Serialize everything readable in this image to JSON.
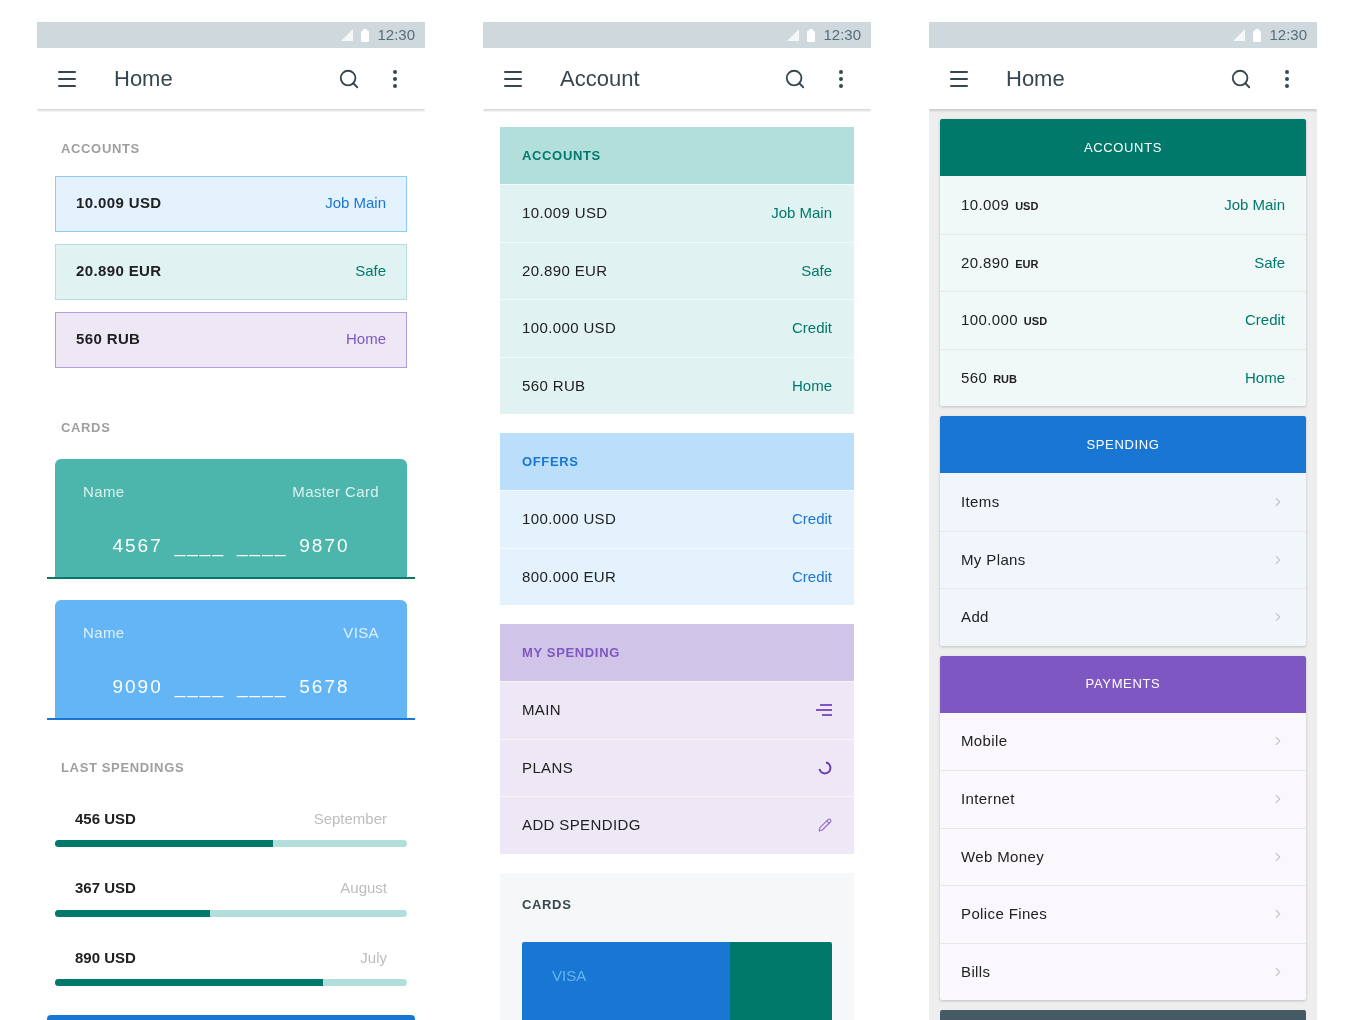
{
  "screens": [
    {
      "status_time": "12:30",
      "title": "Home",
      "accounts_label": "ACCOUNTS",
      "accounts": [
        {
          "amount": "10.009 USD",
          "name": "Job Main",
          "color": "#1976d2"
        },
        {
          "amount": "20.890 EUR",
          "name": "Safe",
          "color": "#00796b"
        },
        {
          "amount": "560 RUB",
          "name": "Home",
          "color": "#7e57c2"
        }
      ],
      "cards_label": "CARDS",
      "cards": [
        {
          "name": "Name",
          "brand": "Master Card",
          "number": [
            "4567",
            "____",
            "____",
            "9870"
          ],
          "color": "#4db6ac"
        },
        {
          "name": "Name",
          "brand": "VISA",
          "number": [
            "9090",
            "____",
            "____",
            "5678"
          ],
          "color": "#64b5f6"
        }
      ],
      "spendings_label": "LAST SPENDINGS",
      "spendings": [
        {
          "amount": "456 USD",
          "month": "September",
          "level": 0.62
        },
        {
          "amount": "367 USD",
          "month": "August",
          "level": 0.44
        },
        {
          "amount": "890 USD",
          "month": "July",
          "level": 0.76
        }
      ]
    },
    {
      "status_time": "12:30",
      "title": "Account",
      "sections": [
        {
          "title": "ACCOUNTS",
          "color": "#00796b",
          "rows": [
            {
              "label": "10.009 USD",
              "value": "Job Main"
            },
            {
              "label": "20.890 EUR",
              "value": "Safe"
            },
            {
              "label": "100.000 USD",
              "value": "Credit"
            },
            {
              "label": "560 RUB",
              "value": "Home"
            }
          ]
        },
        {
          "title": "OFFERS",
          "color": "#1976d2",
          "rows": [
            {
              "label": "100.000 USD",
              "value": "Credit"
            },
            {
              "label": "800.000 EUR",
              "value": "Credit"
            }
          ]
        },
        {
          "title": "MY SPENDING",
          "color": "#7e57c2",
          "rows": [
            {
              "label": "MAIN",
              "kind": "lines"
            },
            {
              "label": "PLANS",
              "kind": "spinner"
            },
            {
              "label": "ADD SPENDIDG",
              "kind": "pencil"
            }
          ]
        }
      ],
      "cards_label": "CARDS",
      "card_brand": "VISA"
    },
    {
      "status_time": "12:30",
      "title": "Home",
      "groups": [
        {
          "title": "ACCOUNTS",
          "color": "#00796b",
          "rows": [
            {
              "amount": "10.009",
              "currency": "USD",
              "value": "Job Main"
            },
            {
              "amount": "20.890",
              "currency": "EUR",
              "value": "Safe"
            },
            {
              "amount": "100.000",
              "currency": "USD",
              "value": "Credit"
            },
            {
              "amount": "560",
              "currency": "RUB",
              "value": "Home"
            }
          ]
        },
        {
          "title": "SPENDING",
          "color": "#1976d2",
          "rows": [
            {
              "label": "Items"
            },
            {
              "label": "My Plans"
            },
            {
              "label": "Add"
            }
          ]
        },
        {
          "title": "PAYMENTS",
          "color": "#7e57c2",
          "rows": [
            {
              "label": "Mobile"
            },
            {
              "label": "Internet"
            },
            {
              "label": "Web Money"
            },
            {
              "label": "Police Fines"
            },
            {
              "label": "Bills"
            }
          ]
        }
      ]
    }
  ]
}
